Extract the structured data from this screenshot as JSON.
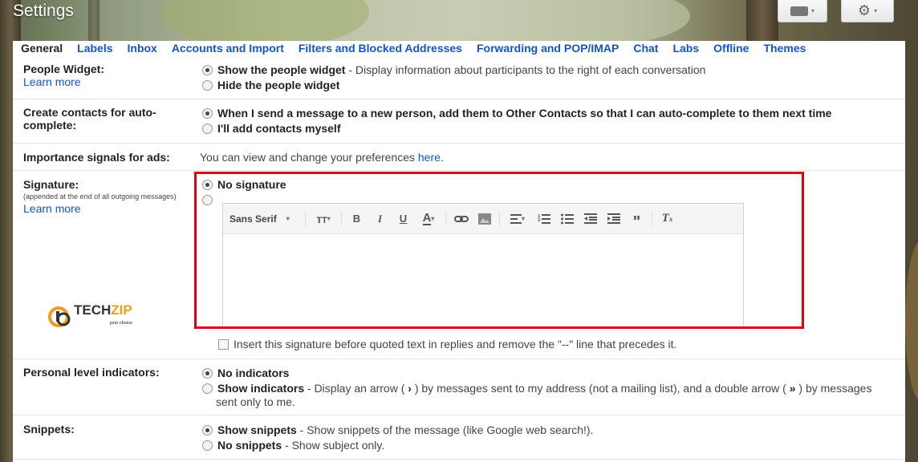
{
  "app": {
    "title": "Settings"
  },
  "tabs": [
    {
      "label": "General"
    },
    {
      "label": "Labels"
    },
    {
      "label": "Inbox"
    },
    {
      "label": "Accounts and Import"
    },
    {
      "label": "Filters and Blocked Addresses"
    },
    {
      "label": "Forwarding and POP/IMAP"
    },
    {
      "label": "Chat"
    },
    {
      "label": "Labs"
    },
    {
      "label": "Offline"
    },
    {
      "label": "Themes"
    }
  ],
  "learn_more": "Learn more",
  "people_widget": {
    "label": "People Widget:",
    "opt1_bold": "Show the people widget",
    "opt1_desc": " - Display information about participants to the right of each conversation",
    "opt2_bold": "Hide the people widget"
  },
  "contacts": {
    "label_line1": "Create contacts for auto-",
    "label_line2": "complete:",
    "opt1_bold": "When I send a message to a new person, add them to Other Contacts so that I can auto-complete to them next time",
    "opt2_bold": "I'll add contacts myself"
  },
  "importance": {
    "label": "Importance signals for ads:",
    "text": "You can view and change your preferences ",
    "link": "here",
    "after": "."
  },
  "signature": {
    "label": "Signature:",
    "sub": "(appended at the end of all outgoing messages)",
    "opt1_bold": "No signature",
    "font_name": "Sans Serif",
    "insert_text": "Insert this signature before quoted text in replies and remove the \"--\" line that precedes it."
  },
  "logo": {
    "text_a": "TECH",
    "text_b": "ZIP",
    "tagline": "your choice"
  },
  "personal": {
    "label": "Personal level indicators:",
    "opt1_bold": "No indicators",
    "opt2_bold": "Show indicators",
    "opt2_desc_a": " - Display an arrow ( ",
    "arrow1": "›",
    "opt2_desc_b": " ) by messages sent to my address (not a mailing list), and a double arrow ( ",
    "arrow2": "»",
    "opt2_desc_c": " ) by messages",
    "opt2_desc_line2": "sent only to me."
  },
  "snippets": {
    "label": "Snippets:",
    "opt1_bold": "Show snippets",
    "opt1_desc": " - Show snippets of the message (like Google web search!).",
    "opt2_bold": "No snippets",
    "opt2_desc": " - Show subject only."
  },
  "icons": [
    "keyboard-icon",
    "gear-icon",
    "radio-icon",
    "checkbox-icon",
    "bold-icon",
    "italic-icon",
    "underline-icon",
    "text-color-icon",
    "link-icon",
    "image-icon",
    "align-icon",
    "numbered-list-icon",
    "bulleted-list-icon",
    "indent-less-icon",
    "indent-more-icon",
    "quote-icon",
    "remove-formatting-icon",
    "font-size-icon"
  ],
  "colors": {
    "link": "#1155cc",
    "highlight_border": "#e3000f",
    "logo_accent": "#f29c1f"
  }
}
